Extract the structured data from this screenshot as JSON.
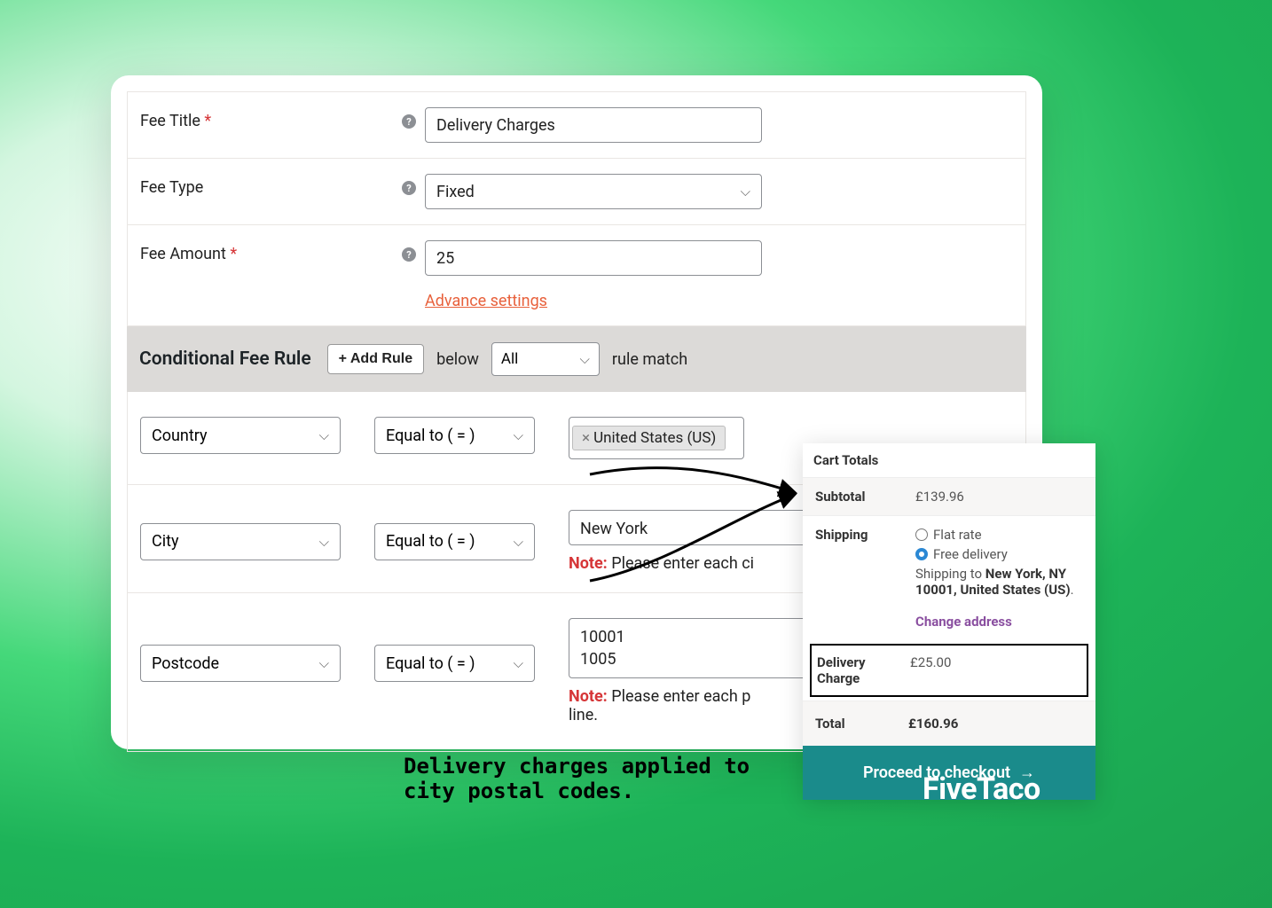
{
  "form": {
    "fee_title_label": "Fee Title",
    "fee_title_value": "Delivery Charges",
    "fee_type_label": "Fee Type",
    "fee_type_value": "Fixed",
    "fee_amount_label": "Fee Amount",
    "fee_amount_value": "25",
    "advance_link": "Advance settings"
  },
  "conditional": {
    "title": "Conditional Fee Rule",
    "add_rule": "+ Add Rule",
    "below": "below",
    "match_select": "All",
    "rule_match": "rule match"
  },
  "rules": [
    {
      "field": "Country",
      "op": "Equal to ( = )",
      "value": "United States (US)",
      "note": ""
    },
    {
      "field": "City",
      "op": "Equal to ( = )",
      "value": "New York",
      "note": "Please enter each ci"
    },
    {
      "field": "Postcode",
      "op": "Equal to ( = )",
      "value": "10001\n1005",
      "note": "Please enter each p",
      "note2": "line."
    }
  ],
  "note_label": "Note:",
  "cart": {
    "title": "Cart Totals",
    "subtotal_label": "Subtotal",
    "subtotal_value": "£139.96",
    "shipping_label": "Shipping",
    "flat_rate": "Flat rate",
    "free_delivery": "Free delivery",
    "ship_to_pre": "Shipping to ",
    "ship_to_bold": "New York, NY 10001, United States (US)",
    "ship_to_dot": ".",
    "change_address": "Change address",
    "delivery_label": "Delivery Charge",
    "delivery_value": "£25.00",
    "total_label": "Total",
    "total_value": "£160.96",
    "checkout": "Proceed to checkout"
  },
  "caption": "Delivery charges applied to city postal codes.",
  "watermark": "FiveTaco"
}
